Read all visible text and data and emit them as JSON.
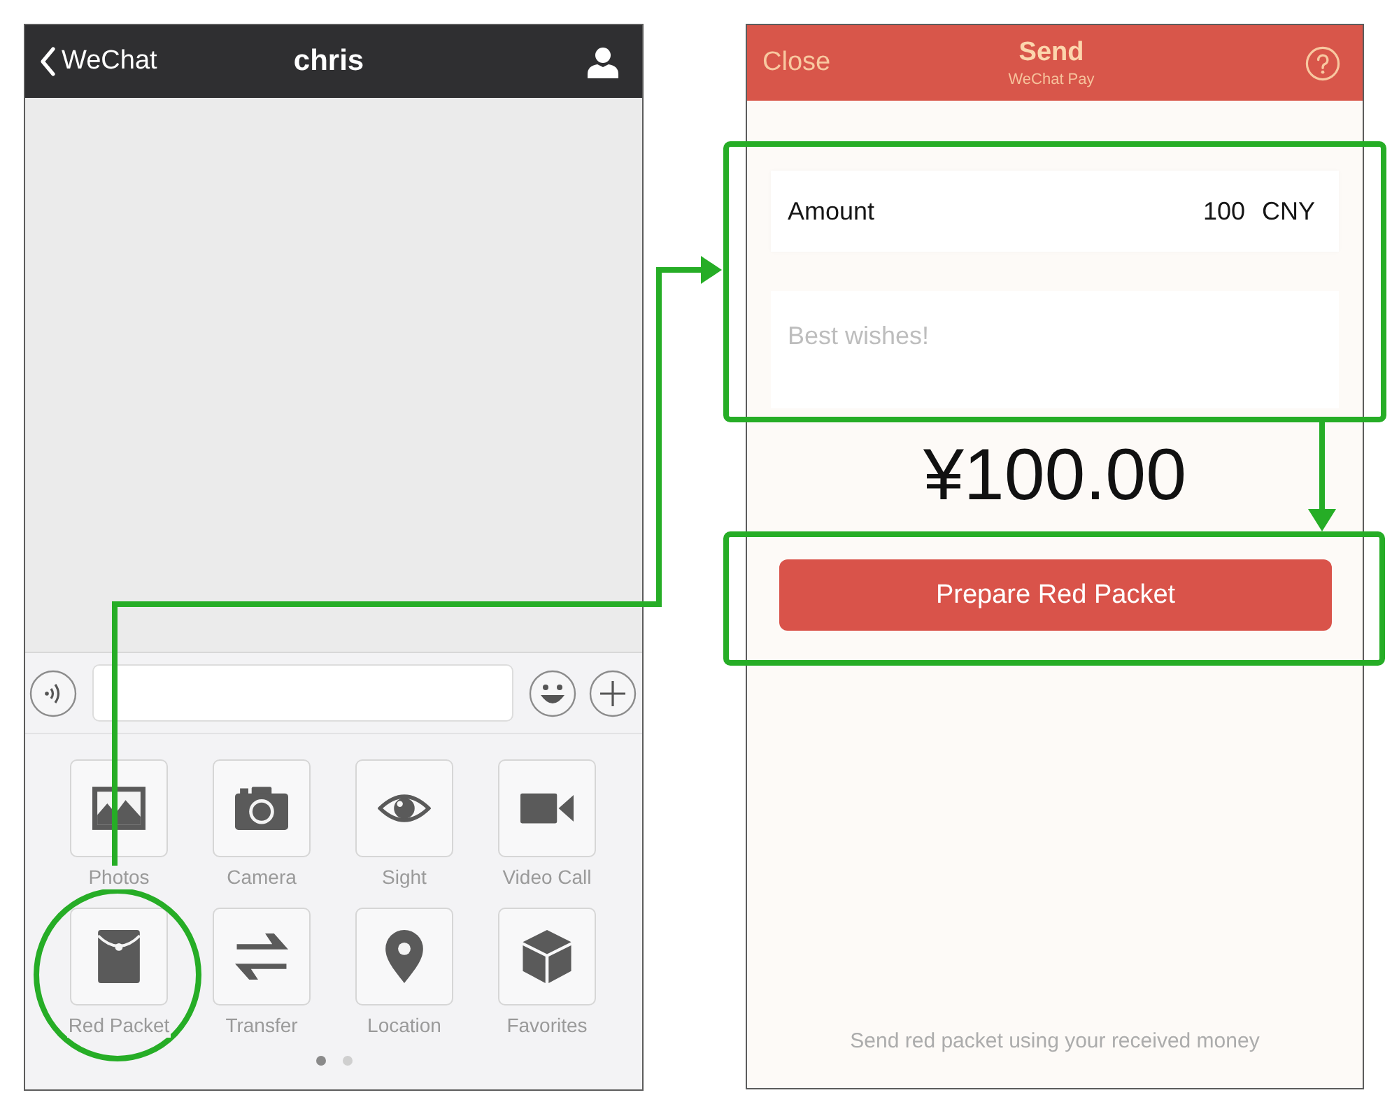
{
  "chat_screen": {
    "header": {
      "back_label": "WeChat",
      "title": "chris"
    },
    "attachments": [
      {
        "kind": "photos",
        "label": "Photos"
      },
      {
        "kind": "camera",
        "label": "Camera"
      },
      {
        "kind": "sight",
        "label": "Sight"
      },
      {
        "kind": "video_call",
        "label": "Video Call"
      },
      {
        "kind": "red_packet",
        "label": "Red Packet"
      },
      {
        "kind": "transfer",
        "label": "Transfer"
      },
      {
        "kind": "location",
        "label": "Location"
      },
      {
        "kind": "favorites",
        "label": "Favorites"
      }
    ],
    "page_dots": [
      {
        "selected": true
      },
      {
        "selected": false
      }
    ]
  },
  "send_screen": {
    "header": {
      "close_label": "Close",
      "title": "Send",
      "subtitle": "WeChat Pay"
    },
    "amount": {
      "label": "Amount",
      "value": "100",
      "currency": "CNY"
    },
    "message": {
      "placeholder": "Best wishes!"
    },
    "total": "¥100.00",
    "button_label": "Prepare Red Packet",
    "footer_note": "Send red packet using your received money"
  }
}
